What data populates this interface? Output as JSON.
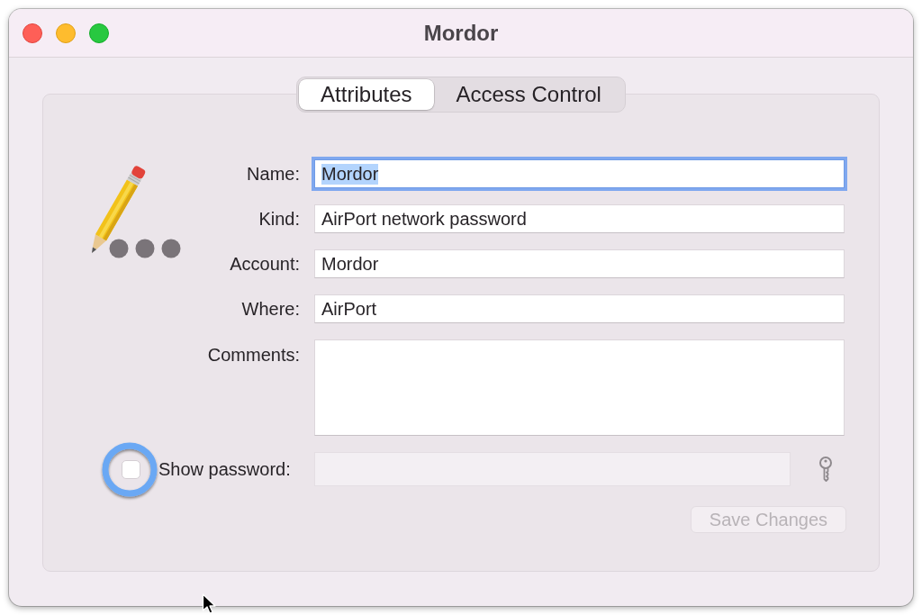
{
  "window": {
    "title": "Mordor"
  },
  "tabs": [
    {
      "label": "Attributes",
      "selected": true
    },
    {
      "label": "Access Control",
      "selected": false
    }
  ],
  "fields": [
    {
      "label": "Name:",
      "kind": "text",
      "value": "Mordor",
      "focused": true
    },
    {
      "label": "Kind:",
      "kind": "text",
      "value": "AirPort network password",
      "focused": false
    },
    {
      "label": "Account:",
      "kind": "text",
      "value": "Mordor",
      "focused": false
    },
    {
      "label": "Where:",
      "kind": "text",
      "value": "AirPort",
      "focused": false
    },
    {
      "label": "Comments:",
      "kind": "textarea",
      "focused": false
    }
  ],
  "show_password": {
    "label": "Show password:",
    "checked": false,
    "highlighted": true
  },
  "password_field": {
    "disabled": true
  },
  "save_button": {
    "label": "Save Changes",
    "disabled": true
  }
}
